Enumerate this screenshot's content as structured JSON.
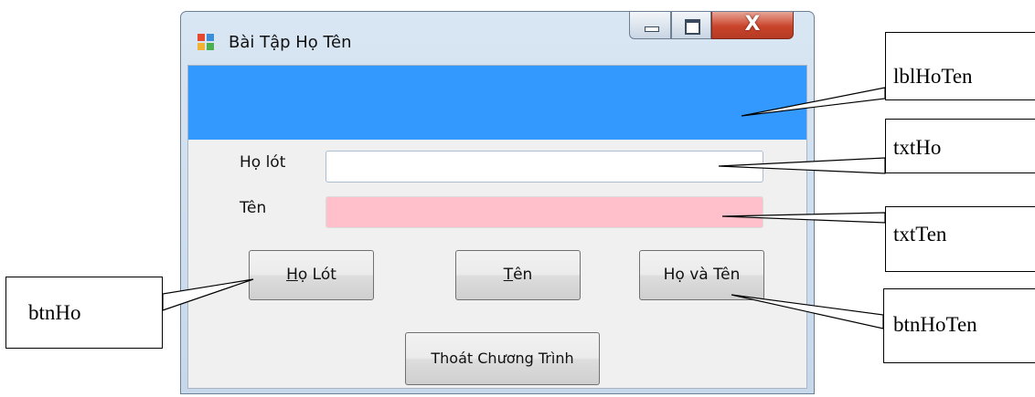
{
  "window": {
    "title": "Bài Tập Họ Tên",
    "close_glyph": "X",
    "icons": [
      "app-form-icon",
      "minimize-icon",
      "maximize-icon",
      "close-icon"
    ]
  },
  "form": {
    "label_holot": "Họ lót",
    "label_ten": "Tên",
    "txt_ho_value": "",
    "txt_ten_value": "",
    "txt_ten_color": "#ffc0cb",
    "label_hoten_color": "#3399ff"
  },
  "buttons": {
    "ho_mnemonic": "H",
    "ho_rest": "ọ Lót",
    "ten_mnemonic": "T",
    "ten_rest": "ên",
    "hoten": "Họ và Tên",
    "exit": "Thoát Chương Trình"
  },
  "callouts": {
    "lblHoTen": "lblHoTen",
    "txtHo": "txtHo",
    "txtTen": "txtTen",
    "btnHo": "btnHo",
    "btnHoTen": "btnHoTen"
  }
}
